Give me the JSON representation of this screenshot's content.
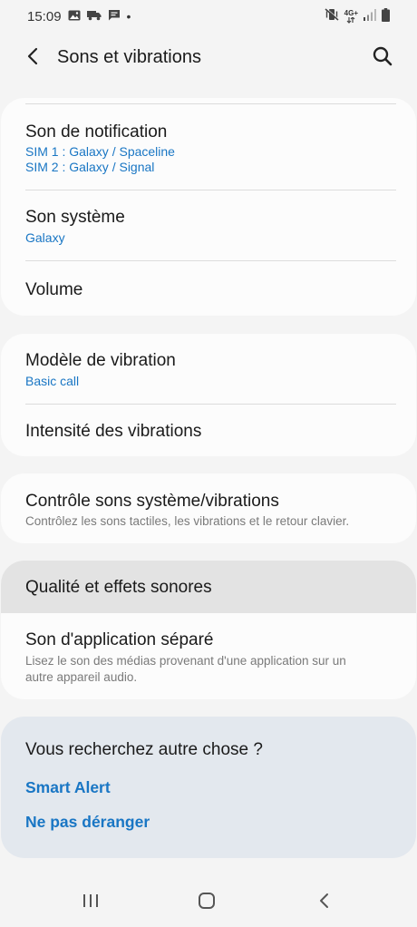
{
  "status": {
    "time": "15:09",
    "dot": "•",
    "network": "4G+"
  },
  "header": {
    "title": "Sons et vibrations"
  },
  "card1": {
    "notification": {
      "title": "Son de notification",
      "sub1": "SIM 1 : Galaxy / Spaceline",
      "sub2": "SIM 2 : Galaxy / Signal"
    },
    "system": {
      "title": "Son système",
      "sub": "Galaxy"
    },
    "volume": {
      "title": "Volume"
    }
  },
  "card2": {
    "vibration_pattern": {
      "title": "Modèle de vibration",
      "sub": "Basic call"
    },
    "vibration_intensity": {
      "title": "Intensité des vibrations"
    }
  },
  "card3": {
    "system_control": {
      "title": "Contrôle sons système/vibrations",
      "sub": "Contrôlez les sons tactiles, les vibrations et le retour clavier."
    }
  },
  "card4": {
    "quality": {
      "title": "Qualité et effets sonores"
    },
    "separate_app": {
      "title": "Son d'application séparé",
      "sub_line1": "Lisez le son des médias provenant d'une application sur un",
      "sub_line2": "autre appareil audio."
    }
  },
  "suggestions": {
    "title": "Vous recherchez autre chose ?",
    "links": [
      "Smart Alert",
      "Ne pas déranger"
    ]
  },
  "colors": {
    "accent": "#1976c4",
    "background": "#f4f4f4",
    "card": "#fcfcfc",
    "suggest_bg": "#e3e8ee",
    "highlight": "#e3e3e3"
  },
  "icons": {
    "back": "chevron-left-icon",
    "search": "search-icon",
    "nav_recents": "recent-apps-icon",
    "nav_home": "home-icon",
    "nav_back": "nav-back-icon"
  }
}
